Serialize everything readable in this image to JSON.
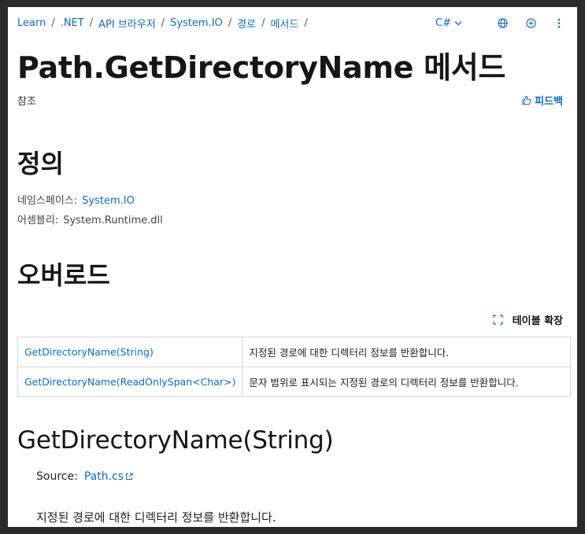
{
  "breadcrumb": {
    "items": [
      "Learn",
      ".NET",
      "API 브라우저",
      "System.IO",
      "경로",
      "메서드"
    ],
    "separator": "/"
  },
  "toolbar": {
    "language": "C#",
    "icons": [
      "chevron-down-icon",
      "globe-icon",
      "plus-circle-icon",
      "more-vertical-icon"
    ]
  },
  "page": {
    "title": "Path.GetDirectoryName 메서드",
    "reference_label": "참조",
    "feedback_label": "피드백"
  },
  "definition": {
    "heading": "정의",
    "namespace_label": "네임스페이스:",
    "namespace_value": "System.IO",
    "assembly_label": "어셈블리:",
    "assembly_value": "System.Runtime.dll"
  },
  "overloads": {
    "heading": "오버로드",
    "expand_label": "테이블 확장",
    "rows": [
      {
        "name": "GetDirectoryName(String)",
        "description": "지정된 경로에 대한 디렉터리 정보를 반환합니다."
      },
      {
        "name": "GetDirectoryName(ReadOnlySpan<Char>)",
        "description": "문자 범위로 표시되는 지정된 경로의 디렉터리 정보를 반환합니다."
      }
    ]
  },
  "method_section": {
    "heading": "GetDirectoryName(String)",
    "source_label": "Source:",
    "source_link": "Path.cs",
    "summary": "지정된 경로에 대한 디렉터리 정보를 반환합니다."
  },
  "colors": {
    "link": "#0f6cbd",
    "text": "#161616",
    "border": "#d6d6d6"
  }
}
